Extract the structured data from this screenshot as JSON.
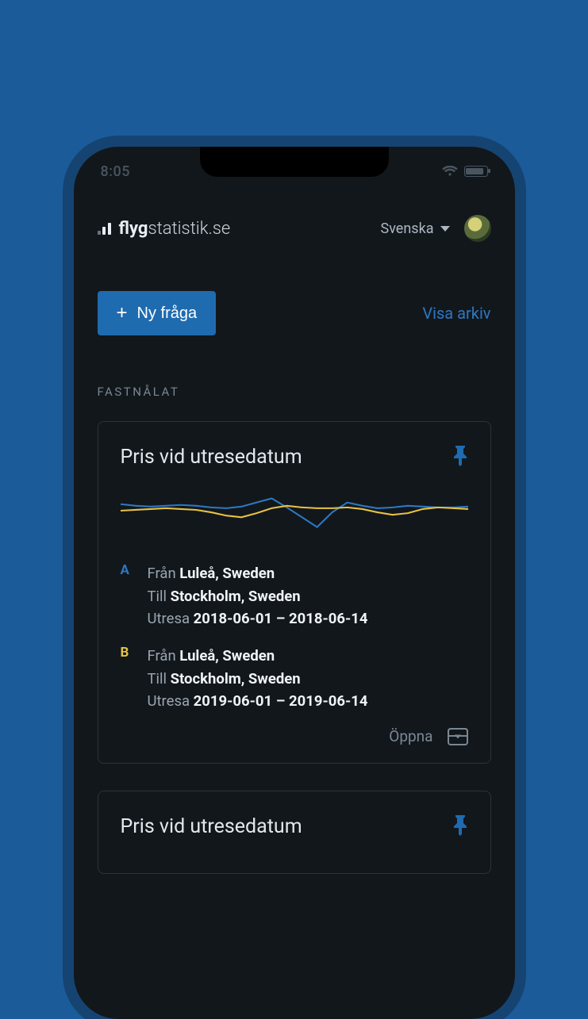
{
  "status": {
    "time": "8:05"
  },
  "brand": {
    "bold": "flyg",
    "thin": "statistik.se"
  },
  "topbar": {
    "language": "Svenska"
  },
  "actions": {
    "new_question": "Ny fråga",
    "view_archive": "Visa arkiv"
  },
  "section": {
    "pinned_label": "FASTNÅLAT"
  },
  "labels": {
    "from": "Från",
    "to": "Till",
    "departure": "Utresa",
    "open": "Öppna"
  },
  "cards": [
    {
      "title": "Pris vid utresedatum",
      "series": [
        {
          "tag": "A",
          "from": "Luleå, Sweden",
          "to": "Stockholm, Sweden",
          "dates": "2018-06-01 – 2018-06-14"
        },
        {
          "tag": "B",
          "from": "Luleå, Sweden",
          "to": "Stockholm, Sweden",
          "dates": "2019-06-01 – 2019-06-14"
        }
      ]
    },
    {
      "title": "Pris vid utresedatum"
    }
  ],
  "colors": {
    "accent": "#1f6bb0",
    "seriesA": "#2d78c0",
    "seriesB": "#e6c244"
  },
  "chart_data": {
    "type": "line",
    "title": "Pris vid utresedatum",
    "xlabel": "",
    "ylabel": "",
    "series": [
      {
        "name": "A",
        "color": "#2d78c0",
        "values": [
          38,
          36,
          35,
          36,
          37,
          36,
          34,
          33,
          35,
          40,
          45,
          34,
          22,
          10,
          28,
          40,
          36,
          33,
          34,
          36,
          35,
          34,
          34,
          35
        ]
      },
      {
        "name": "B",
        "color": "#e6c244",
        "values": [
          30,
          31,
          32,
          33,
          32,
          31,
          28,
          24,
          22,
          27,
          33,
          36,
          34,
          33,
          33,
          34,
          32,
          28,
          25,
          27,
          32,
          34,
          33,
          32
        ]
      }
    ],
    "ylim": [
      0,
      60
    ]
  }
}
